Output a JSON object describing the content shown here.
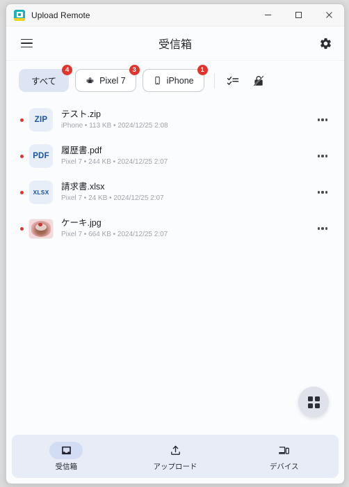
{
  "window": {
    "title": "Upload Remote",
    "app_icon": "upload-remote-app-icon",
    "controls": {
      "minimize": "minimize-button",
      "maximize": "maximize-button",
      "close": "close-button"
    }
  },
  "header": {
    "menu_icon": "hamburger-menu-icon",
    "title": "受信箱",
    "settings_icon": "gear-icon"
  },
  "filters": {
    "chips": [
      {
        "label": "すべて",
        "badge": "4",
        "icon": "none",
        "active": true
      },
      {
        "label": "Pixel 7",
        "badge": "3",
        "icon": "android-icon",
        "active": false
      },
      {
        "label": "iPhone",
        "badge": "1",
        "icon": "smartphone-icon",
        "active": false
      }
    ],
    "actions": [
      {
        "name": "select-multiple-icon"
      },
      {
        "name": "lock-off-icon"
      }
    ]
  },
  "files": [
    {
      "unread": true,
      "kind": "ZIP",
      "name": "テスト.zip",
      "meta": "iPhone • 113 KB • 2024/12/25 2:08",
      "device": "iPhone",
      "size": "113 KB",
      "date": "2024/12/25 2:08",
      "menu": "more-options-icon"
    },
    {
      "unread": true,
      "kind": "PDF",
      "name": "履歴書.pdf",
      "meta": "Pixel 7 • 244 KB • 2024/12/25 2:07",
      "device": "Pixel 7",
      "size": "244 KB",
      "date": "2024/12/25 2:07",
      "menu": "more-options-icon"
    },
    {
      "unread": true,
      "kind": "XLSX",
      "name": "請求書.xlsx",
      "meta": "Pixel 7 • 24 KB • 2024/12/25 2:07",
      "device": "Pixel 7",
      "size": "24 KB",
      "date": "2024/12/25 2:07",
      "menu": "more-options-icon"
    },
    {
      "unread": true,
      "kind": "IMAGE",
      "name": "ケーキ.jpg",
      "meta": "Pixel 7 • 664 KB • 2024/12/25 2:07",
      "device": "Pixel 7",
      "size": "664 KB",
      "date": "2024/12/25 2:07",
      "menu": "more-options-icon"
    }
  ],
  "fab": {
    "icon": "apps-grid-icon"
  },
  "bottom_nav": [
    {
      "label": "受信箱",
      "icon": "inbox-tray-icon",
      "active": true
    },
    {
      "label": "アップロード",
      "icon": "upload-arrow-icon",
      "active": false
    },
    {
      "label": "デバイス",
      "icon": "devices-icon",
      "active": false
    }
  ],
  "colors": {
    "accent_chip": "#dde5f5",
    "badge_red": "#e0342c",
    "filetype_text": "#1a52a0",
    "filetype_bg": "#e7eef8",
    "nav_bg": "#e7ecf6",
    "nav_active_pill": "#d2dcf2",
    "window_bg": "#fbfcfe"
  }
}
